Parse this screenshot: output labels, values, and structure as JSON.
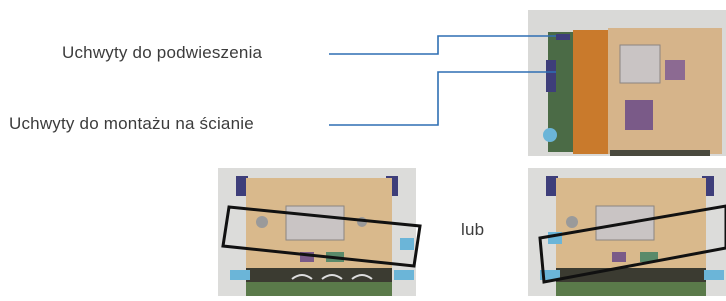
{
  "labels": {
    "hanging_brackets": "Uchwyty do podwieszenia",
    "wall_brackets": "Uchwyty do montażu na ścianie",
    "or": "lub"
  },
  "colors": {
    "leader_line": "#2f6fb3",
    "highlight_frame": "#111111",
    "photo_background": "#d8d8d6",
    "enclosure_body": "#d9b98c",
    "enclosure_dark_band": "#3b3b31",
    "enclosure_green_band": "#5a7a4a",
    "bracket": "#5a4a8a",
    "connector": "#6bb5d8"
  },
  "icons": {
    "callout": "leader-line",
    "highlight": "rotated-rectangle-frame"
  }
}
